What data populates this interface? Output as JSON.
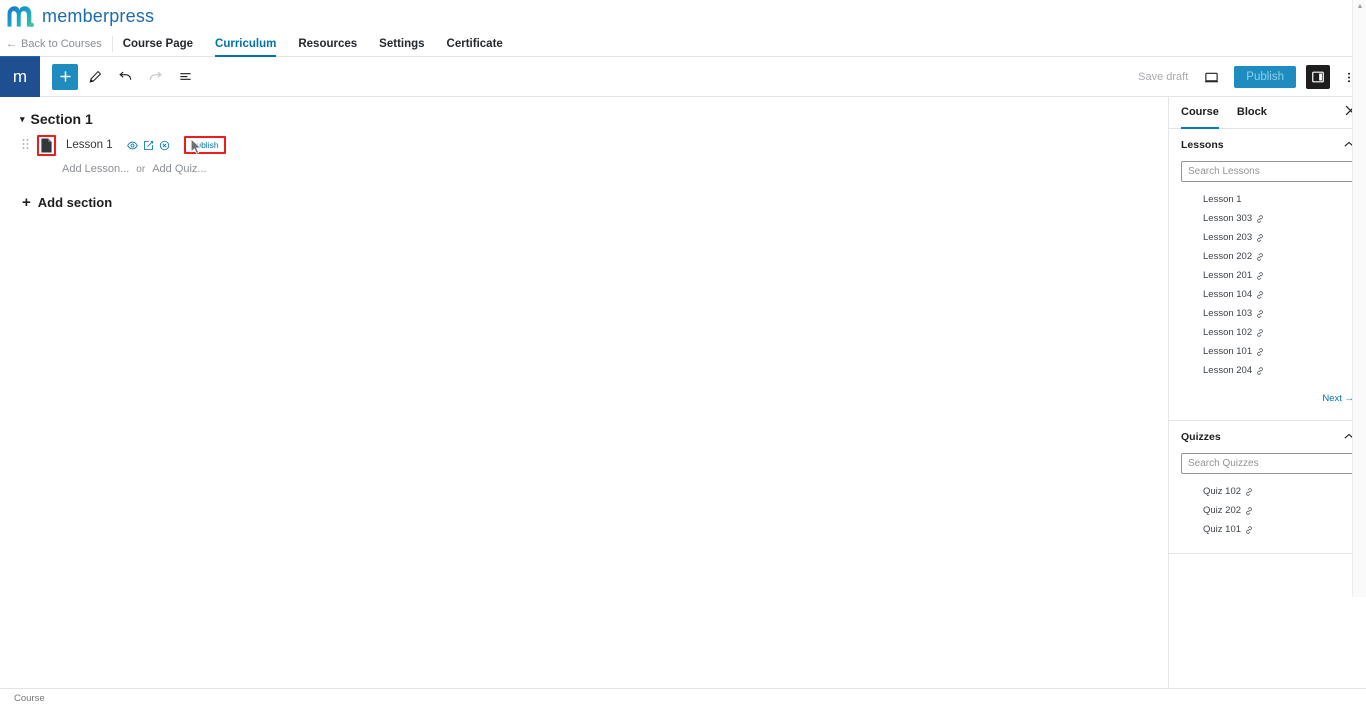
{
  "brand": {
    "name": "memberpress",
    "logo_icon": "memberpress-m-logo"
  },
  "course_nav": {
    "back_label": "Back to Courses",
    "back_arrow": "←",
    "tabs": [
      {
        "label": "Course Page",
        "active": false
      },
      {
        "label": "Curriculum",
        "active": true
      },
      {
        "label": "Resources",
        "active": false
      },
      {
        "label": "Settings",
        "active": false
      },
      {
        "label": "Certificate",
        "active": false
      }
    ]
  },
  "editor_toolbar": {
    "logo_letter": "m",
    "add_block_icon": "plus-icon",
    "tools": [
      {
        "name": "edit-pencil-icon",
        "label": "Tools"
      },
      {
        "name": "undo-icon",
        "label": "Undo"
      },
      {
        "name": "redo-icon",
        "label": "Redo"
      },
      {
        "name": "list-view-icon",
        "label": "Document overview"
      }
    ],
    "save_draft_label": "Save draft",
    "preview_icon": "monitor-preview-icon",
    "publish_label": "Publish",
    "settings_toggle_icon": "settings-sidebar-icon",
    "options_icon": "vertical-ellipsis-icon"
  },
  "curriculum": {
    "section": {
      "title": "Section 1",
      "caret": "▾"
    },
    "lesson": {
      "name": "Lesson 1",
      "doc_icon": "document-icon",
      "drag_icon": "drag-handle-icon",
      "actions": [
        {
          "name": "preview-eye-icon"
        },
        {
          "name": "edit-square-icon"
        },
        {
          "name": "remove-circle-x-icon"
        }
      ],
      "publish_label": "Publish"
    },
    "add_lesson_label": "Add Lesson...",
    "add_or_label": "or",
    "add_quiz_label": "Add Quiz...",
    "add_section_label": "Add section",
    "add_section_plus": "+"
  },
  "sidebar": {
    "tabs": [
      {
        "label": "Course",
        "active": true
      },
      {
        "label": "Block",
        "active": false
      }
    ],
    "close_icon": "close-icon",
    "panels": [
      {
        "title": "Lessons",
        "collapse_icon": "chevron-up-icon",
        "search_placeholder": "Search Lessons",
        "search_value": "",
        "items": [
          {
            "label": "Lesson 1",
            "linked": false
          },
          {
            "label": "Lesson 303",
            "linked": true
          },
          {
            "label": "Lesson 203",
            "linked": true
          },
          {
            "label": "Lesson 202",
            "linked": true
          },
          {
            "label": "Lesson 201",
            "linked": true
          },
          {
            "label": "Lesson 104",
            "linked": true
          },
          {
            "label": "Lesson 103",
            "linked": true
          },
          {
            "label": "Lesson 102",
            "linked": true
          },
          {
            "label": "Lesson 101",
            "linked": true
          },
          {
            "label": "Lesson 204",
            "linked": true
          }
        ],
        "next_label": "Next →"
      },
      {
        "title": "Quizzes",
        "collapse_icon": "chevron-up-icon",
        "search_placeholder": "Search Quizzes",
        "search_value": "",
        "items": [
          {
            "label": "Quiz 102",
            "linked": true
          },
          {
            "label": "Quiz 202",
            "linked": true
          },
          {
            "label": "Quiz 101",
            "linked": true
          }
        ]
      }
    ]
  },
  "statusbar": {
    "text": "Course"
  },
  "colors": {
    "brand_blue": "#1c6bb0",
    "accent_blue": "#0073aa",
    "publish_blue": "#1e8cbe",
    "highlight_red": "#ee1c1c",
    "editor_logo_bg": "#1e4f91"
  }
}
